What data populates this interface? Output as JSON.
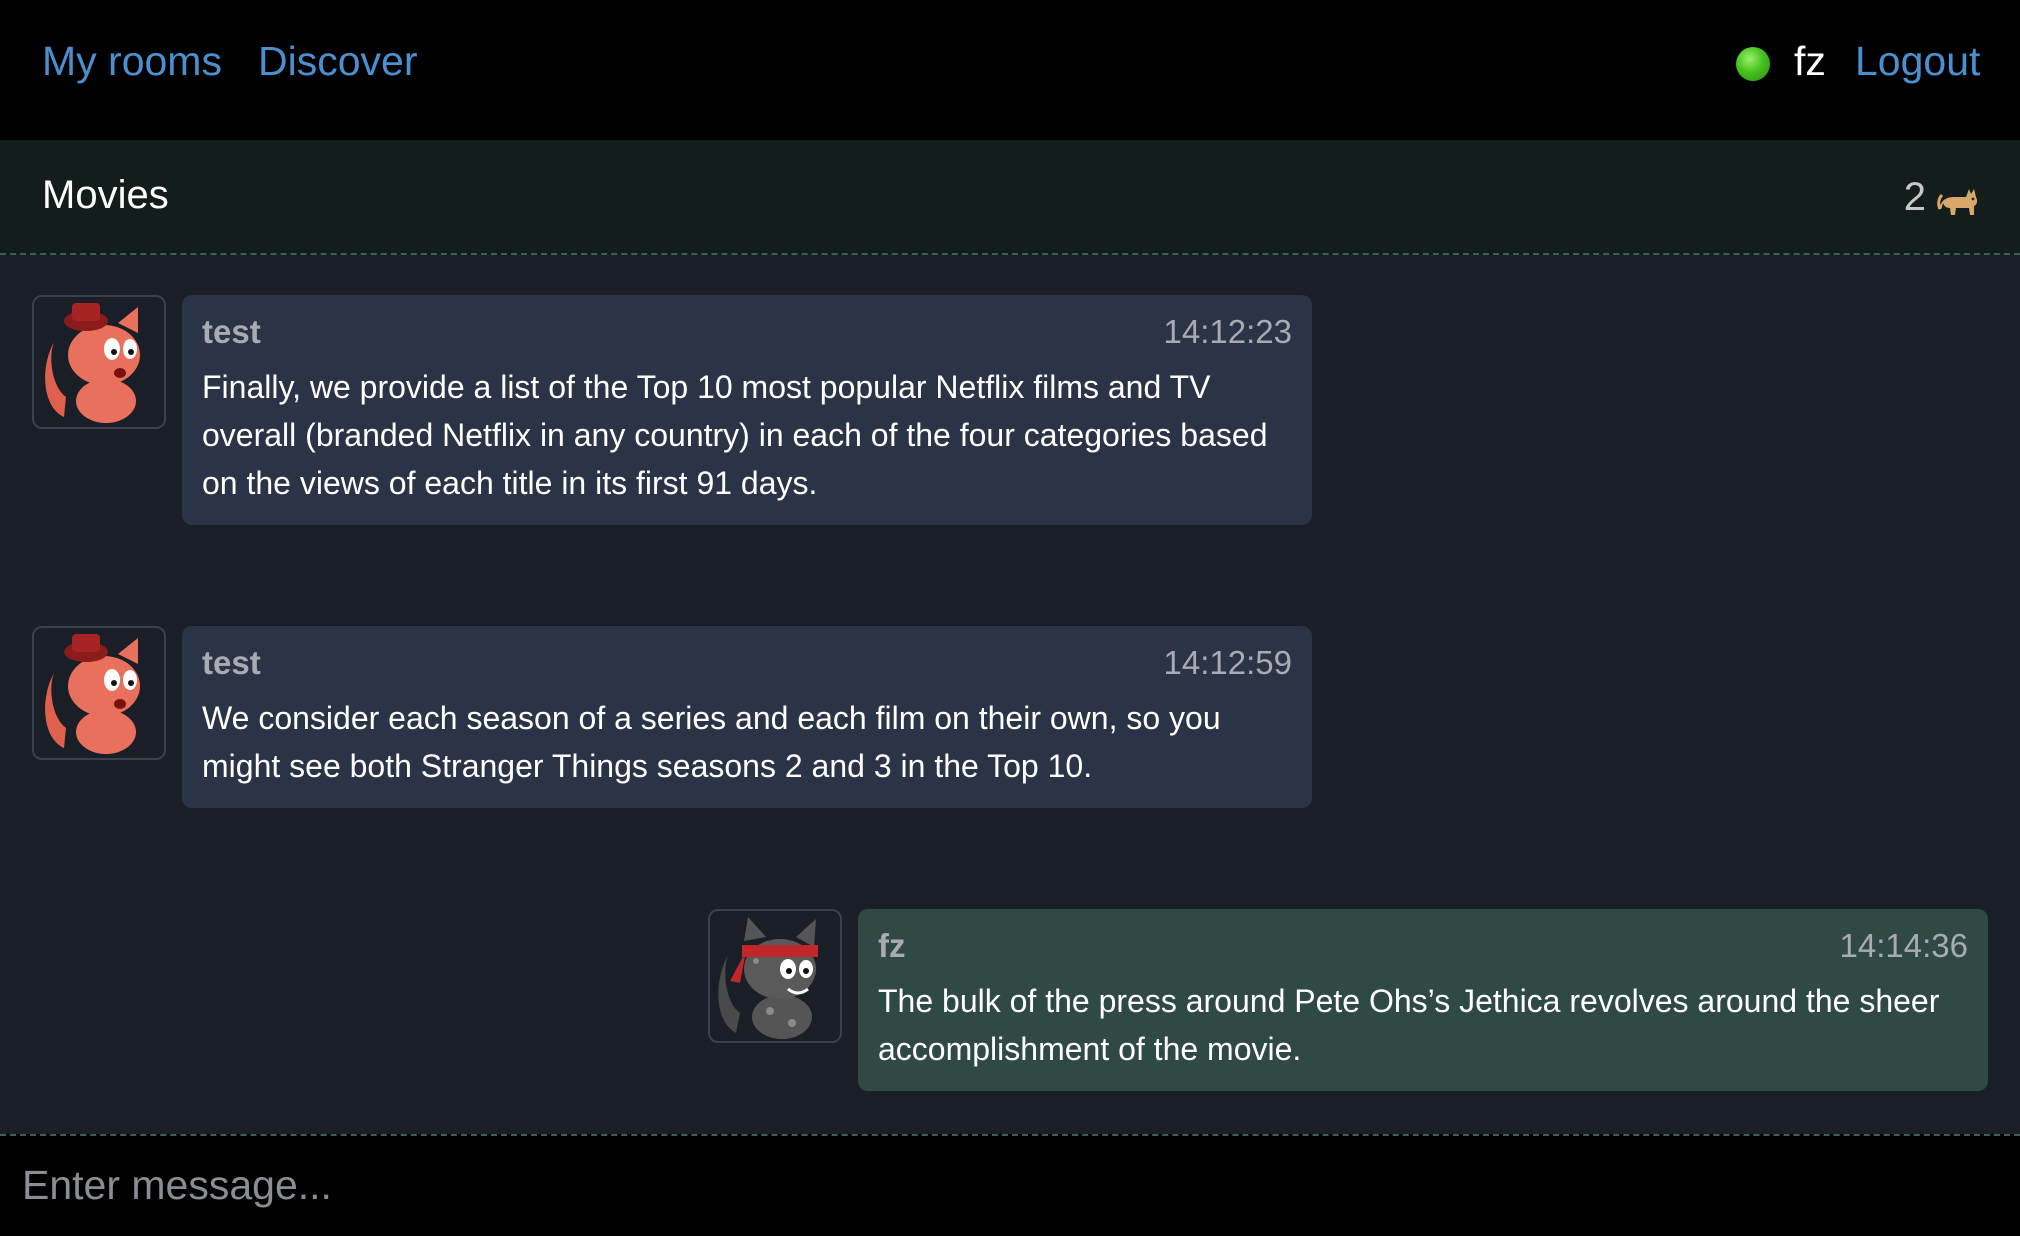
{
  "nav": {
    "my_rooms": "My rooms",
    "discover": "Discover",
    "username": "fz",
    "logout": "Logout",
    "status_color": "#46c21f"
  },
  "room": {
    "name": "Movies",
    "member_count": "2",
    "member_icon": "cat-icon"
  },
  "messages": [
    {
      "author": "test",
      "time": "14:12:23",
      "text": "Finally, we provide a list of the Top 10 most popular Netflix films and TV overall (branded Netflix in any country) in each of the four categories based on the views of each title in its first 91 days.",
      "avatar": "red-cat-with-hat-avatar",
      "own": false
    },
    {
      "author": "test",
      "time": "14:12:59",
      "text": "We consider each season of a series and each film on their own, so you might see both Stranger Things seasons 2 and 3 in the Top 10.",
      "avatar": "red-cat-with-hat-avatar",
      "own": false
    },
    {
      "author": "fz",
      "time": "14:14:36",
      "text": "The bulk of the press around Pete Ohs’s Jethica revolves around the sheer accomplishment of the movie.",
      "avatar": "gray-cat-with-headband-avatar",
      "own": true
    }
  ],
  "composer": {
    "placeholder": "Enter message...",
    "value": ""
  },
  "colors": {
    "link": "#4a8fcf",
    "other_bubble": "#2b3346",
    "own_bubble": "#2f4a45",
    "background": "#1a1e27"
  }
}
